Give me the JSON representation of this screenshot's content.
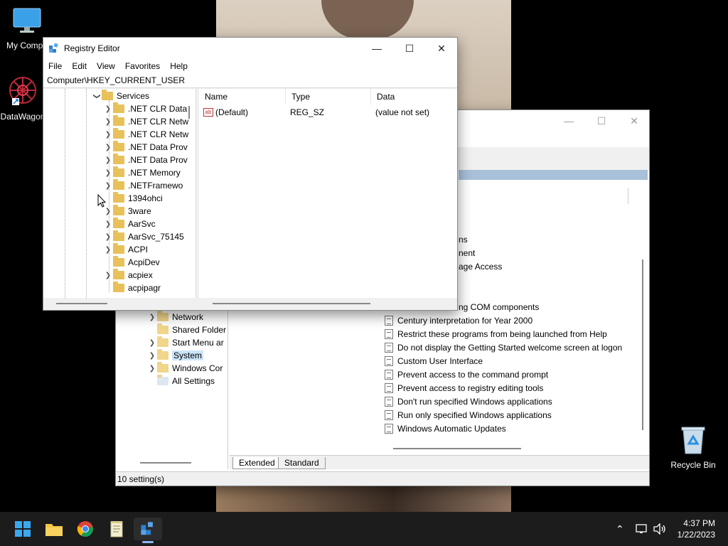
{
  "desktop": {
    "icons": [
      {
        "label": "My Compu"
      },
      {
        "label": "DataWagon"
      },
      {
        "label": "Recycle Bin"
      }
    ]
  },
  "gp_window": {
    "tree": [
      {
        "label": "Network",
        "chevron": true
      },
      {
        "label": "Shared Folder",
        "chevron": false
      },
      {
        "label": "Start Menu ar",
        "chevron": true
      },
      {
        "label": "System",
        "chevron": true,
        "selected": true
      },
      {
        "label": "Windows Cor",
        "chevron": true
      },
      {
        "label": "All Settings",
        "chevron": false
      }
    ],
    "partial_lines": [
      "ns",
      "nent",
      "age Access",
      "ng COM components"
    ],
    "settings": [
      "Century interpretation for Year 2000",
      "Restrict these programs from being launched from Help",
      "Do not display the Getting Started welcome screen at logon",
      "Custom User Interface",
      "Prevent access to the command prompt",
      "Prevent access to registry editing tools",
      "Don't run specified Windows applications",
      "Run only specified Windows applications",
      "Windows Automatic Updates"
    ],
    "tabs": {
      "extended": "Extended",
      "standard": "Standard"
    },
    "status": "10 setting(s)"
  },
  "registry": {
    "title": "Registry Editor",
    "menu": {
      "file": "File",
      "edit": "Edit",
      "view": "View",
      "favorites": "Favorites",
      "help": "Help"
    },
    "address": "Computer\\HKEY_CURRENT_USER",
    "tree_root": "Services",
    "tree_items": [
      {
        "label": ".NET CLR Data",
        "chevron": true
      },
      {
        "label": ".NET CLR Netw",
        "chevron": true
      },
      {
        "label": ".NET CLR Netw",
        "chevron": true
      },
      {
        "label": ".NET Data Prov",
        "chevron": true
      },
      {
        "label": ".NET Data Prov",
        "chevron": true
      },
      {
        "label": ".NET Memory",
        "chevron": true
      },
      {
        "label": ".NETFramewo",
        "chevron": true
      },
      {
        "label": "1394ohci",
        "chevron": false
      },
      {
        "label": "3ware",
        "chevron": true
      },
      {
        "label": "AarSvc",
        "chevron": true
      },
      {
        "label": "AarSvc_75145",
        "chevron": true
      },
      {
        "label": "ACPI",
        "chevron": true
      },
      {
        "label": "AcpiDev",
        "chevron": false
      },
      {
        "label": "acpiex",
        "chevron": true
      },
      {
        "label": "acpipagr",
        "chevron": false
      }
    ],
    "columns": {
      "name": "Name",
      "type": "Type",
      "data": "Data"
    },
    "values": [
      {
        "name": "(Default)",
        "type": "REG_SZ",
        "data": "(value not set)"
      }
    ]
  },
  "taskbar": {
    "apps": [
      "start-icon",
      "file-explorer-icon",
      "chrome-icon",
      "notepad-icon",
      "registry-editor-icon"
    ],
    "time": "4:37 PM",
    "date": "1/22/2023"
  }
}
